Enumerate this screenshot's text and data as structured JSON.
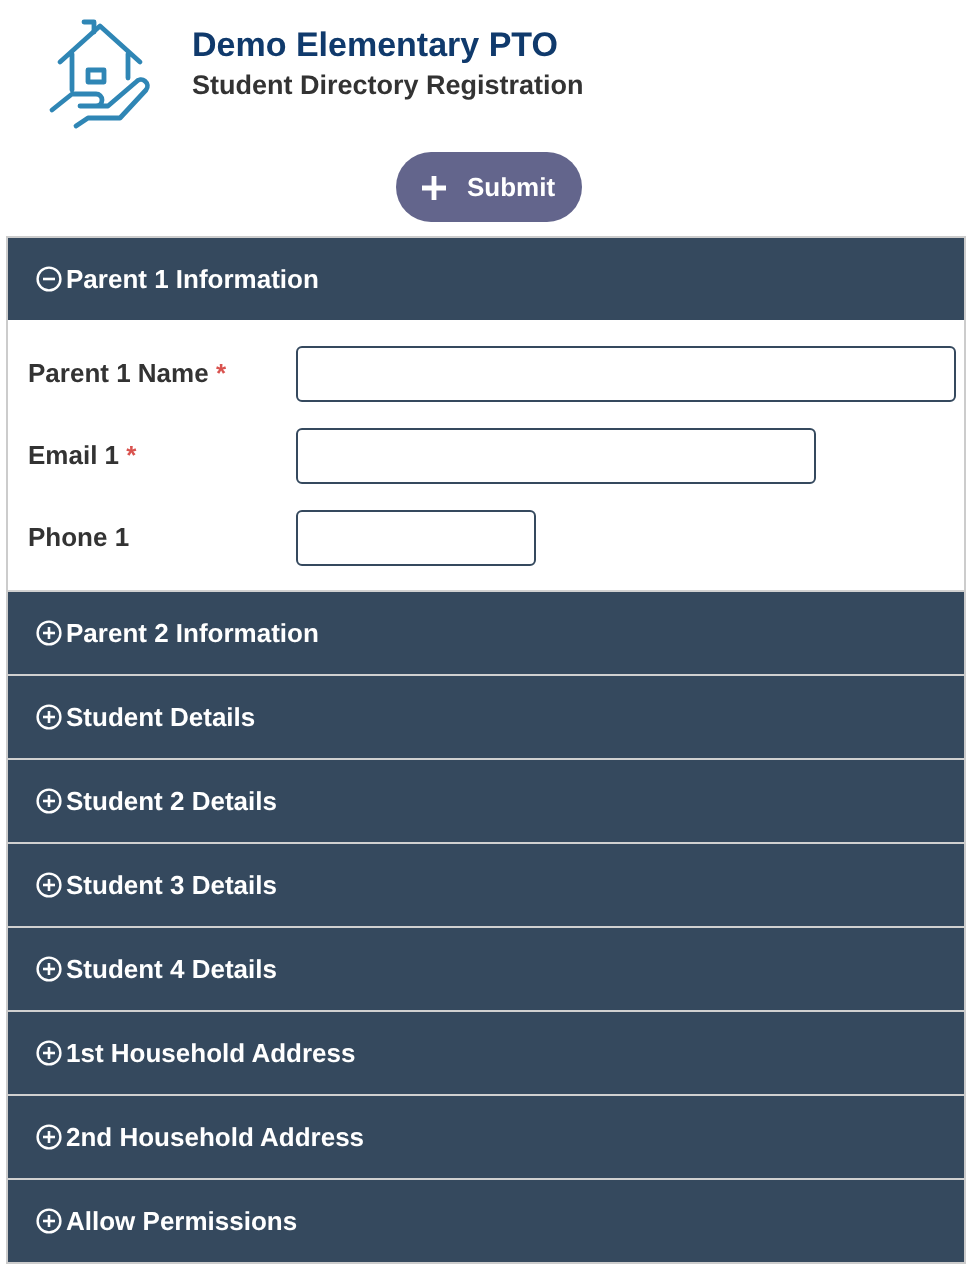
{
  "header": {
    "title": "Demo Elementary PTO",
    "subtitle": "Student Directory Registration"
  },
  "submit": {
    "label": "Submit"
  },
  "sections": [
    {
      "title": "Parent 1 Information",
      "expanded": true,
      "fields": [
        {
          "label": "Parent 1 Name",
          "required_mark": "*",
          "kind": "name"
        },
        {
          "label": "Email 1",
          "required_mark": "*",
          "kind": "email"
        },
        {
          "label": "Phone 1",
          "kind": "phone"
        }
      ]
    },
    {
      "title": "Parent 2 Information",
      "expanded": false
    },
    {
      "title": "Student Details",
      "expanded": false
    },
    {
      "title": "Student 2 Details",
      "expanded": false
    },
    {
      "title": "Student 3 Details",
      "expanded": false
    },
    {
      "title": "Student 4 Details",
      "expanded": false
    },
    {
      "title": "1st Household Address",
      "expanded": false
    },
    {
      "title": "2nd Household Address",
      "expanded": false
    },
    {
      "title": "Allow Permissions",
      "expanded": false
    }
  ]
}
